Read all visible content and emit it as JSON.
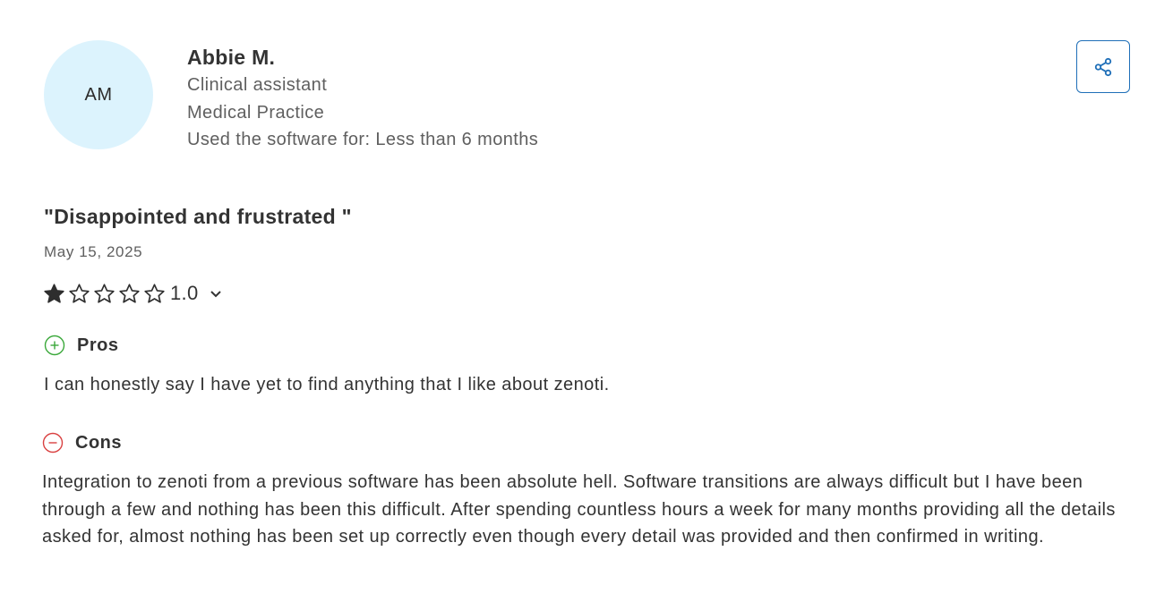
{
  "reviewer": {
    "initials": "AM",
    "name": "Abbie M.",
    "role": "Clinical assistant",
    "industry": "Medical Practice",
    "usage": "Used the software for: Less than 6 months"
  },
  "review": {
    "title": "\"Disappointed and frustrated \"",
    "date": "May 15, 2025",
    "rating": {
      "value": 1.0,
      "max": 5,
      "label": "1.0"
    }
  },
  "pros": {
    "label": "Pros",
    "text": "I can honestly say I have yet to find anything that I like about zenoti."
  },
  "cons": {
    "label": "Cons",
    "text": "Integration to zenoti from a previous software has been absolute hell. Software transitions are always difficult but I have been through a few and nothing has been this difficult. After spending countless hours a week for many months providing all the details asked for, almost nothing has been set up correctly even though every detail was provided and then confirmed in writing."
  },
  "icons": {
    "share": "share-icon",
    "pros": "plus-circle-icon",
    "cons": "minus-circle-icon",
    "expand": "chevron-down-icon",
    "star_filled": "star-filled-icon",
    "star_empty": "star-outline-icon"
  },
  "colors": {
    "avatar_bg": "#dcf3fd",
    "accent": "#1f6fb8",
    "pros": "#3aa83a",
    "cons": "#d94040",
    "star": "#2e2e2e"
  }
}
